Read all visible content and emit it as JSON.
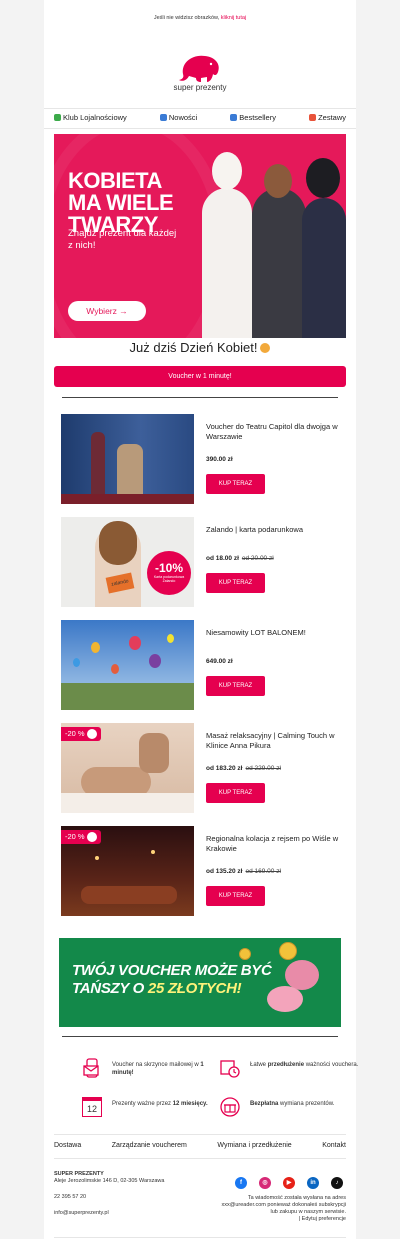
{
  "top_note": {
    "text": "Jeśli nie widzisz obrazków,",
    "link": "kliknij tutaj"
  },
  "logo": {
    "text": "super prezenty",
    "color": "#e5004f"
  },
  "nav": [
    {
      "label": "Klub Lojalnościowy",
      "icon": "money-icon"
    },
    {
      "label": "Nowości",
      "icon": "new-icon"
    },
    {
      "label": "Bestsellery",
      "icon": "top-icon"
    },
    {
      "label": "Zestawy",
      "icon": "gift-icon"
    }
  ],
  "hero": {
    "title": "KOBIETA MA WIELE TWARZY",
    "subtitle": "Znajdź prezent dla każdej z nich!",
    "button": "Wybierz →",
    "bg": "#e5195a"
  },
  "heading": "Już dziś Dzień Kobiet!",
  "cta": "Voucher w 1 minutę!",
  "products": [
    {
      "title": "Voucher do Teatru Capitol dla dwojga w Warszawie",
      "price": "390.00 zł",
      "old": "",
      "button": "KUP TERAZ"
    },
    {
      "title": "Zalando | karta podarunkowa",
      "price": "od 18.00 zł",
      "old": "od 20.00 zł",
      "button": "KUP TERAZ",
      "img_badge": "-10%",
      "img_badge_sub": "Karta podarunkowa Zalando",
      "card_text": "zalando"
    },
    {
      "title": "Niesamowity LOT BALONEM!",
      "price": "649.00 zł",
      "old": "",
      "button": "KUP TERAZ"
    },
    {
      "title": "Masaż relaksacyjny | Calming Touch w Klinice Anna Pikura",
      "price": "od 183.20 zł",
      "old": "od 229.00 zł",
      "button": "KUP TERAZ",
      "badge": "-20 %"
    },
    {
      "title": "Regionalna kolacja z rejsem po Wiśle w Krakowie",
      "price": "od 135.20 zł",
      "old": "od 169.00 zł",
      "button": "KUP TERAZ",
      "badge": "-20 %"
    }
  ],
  "promo": {
    "line1": "TWÓJ VOUCHER MOŻE BYĆ",
    "line2a": "TAŃSZY O ",
    "line2b": "25 ZŁOTYCH!"
  },
  "features": [
    {
      "pre": "Voucher na skrzynce mailowej w ",
      "bold": "1 minutę!",
      "post": ""
    },
    {
      "pre": "Łatwe ",
      "bold": "przedłużenie",
      "post": " ważności vouchera."
    },
    {
      "pre": "Prezenty ważne przez ",
      "bold": "12 miesięcy.",
      "post": "",
      "icon_text": "12"
    },
    {
      "pre": "",
      "bold": "Bezpłatna",
      "post": " wymiana prezentów."
    }
  ],
  "footer_nav": [
    "Dostawa",
    "Zarządzanie voucherem",
    "Wymiana i przedłużenie",
    "Kontakt"
  ],
  "footer": {
    "company": "SUPER PREZENTY",
    "address": "Aleje Jerozolimskie 146 D, 02-305 Warszawa",
    "phone": "22 395 57 20",
    "email": "info@superprezenty.pl",
    "legal1": "Ta wiadomość została wysłana na adres",
    "legal2": "xxx@ureader.com ponieważ dokonałeś subskrypcji",
    "legal3": "lub zakupu w naszym serwisie.",
    "legal4": "| Edytuj preferencje"
  },
  "social": [
    {
      "name": "facebook-icon",
      "label": "f",
      "color": "#1877f2"
    },
    {
      "name": "instagram-icon",
      "label": "◎",
      "color": "#d62976"
    },
    {
      "name": "youtube-icon",
      "label": "▶",
      "color": "#e62117"
    },
    {
      "name": "linkedin-icon",
      "label": "in",
      "color": "#0a66c2"
    },
    {
      "name": "tiktok-icon",
      "label": "♪",
      "color": "#111111"
    }
  ]
}
